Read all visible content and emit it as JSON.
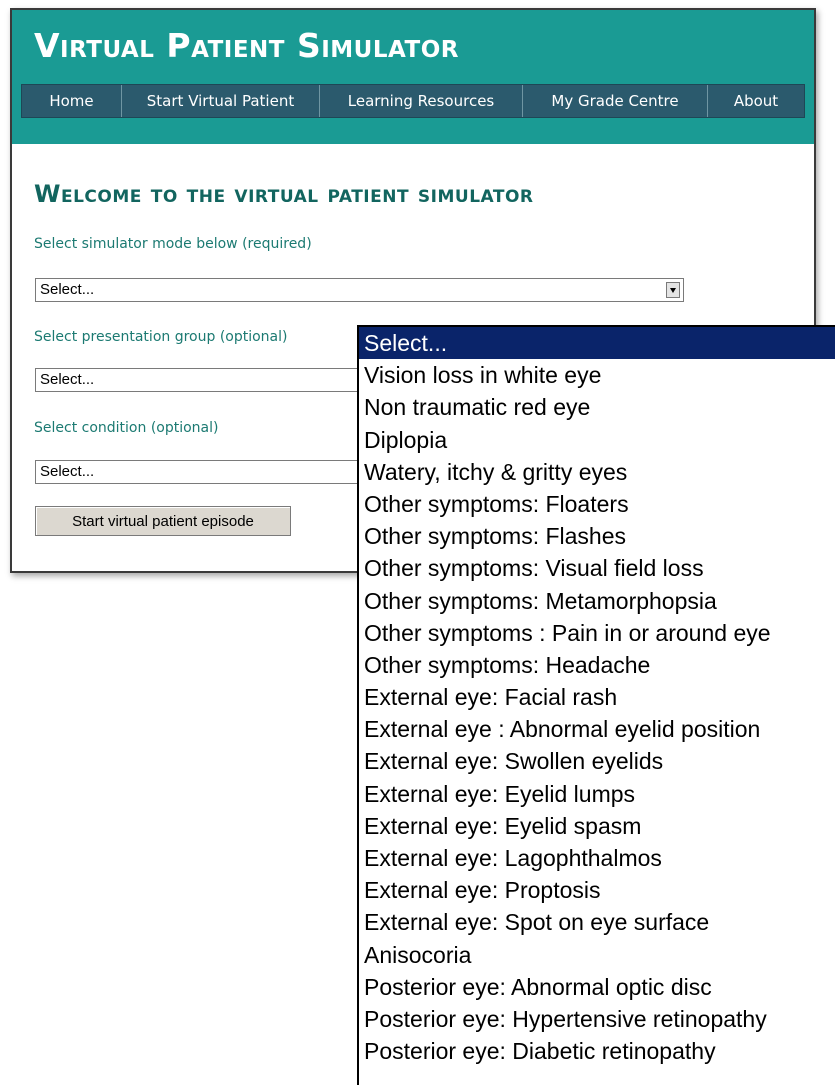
{
  "site": {
    "title": "Virtual Patient Simulator"
  },
  "nav": {
    "items": [
      {
        "label": "Home"
      },
      {
        "label": "Start Virtual Patient"
      },
      {
        "label": "Learning Resources"
      },
      {
        "label": "My Grade Centre"
      },
      {
        "label": "About"
      }
    ]
  },
  "main": {
    "heading": "Welcome to the virtual patient simulator",
    "mode": {
      "label": "Select simulator mode below (required)",
      "value": "Select..."
    },
    "presentation_group": {
      "label": "Select presentation group (optional)",
      "value": "Select..."
    },
    "condition": {
      "label": "Select condition (optional)",
      "value": "Select..."
    },
    "start_button": "Start virtual patient episode"
  },
  "dropdown": {
    "options": [
      "Select...",
      "Vision loss in white eye",
      "Non traumatic red eye",
      "Diplopia",
      "Watery, itchy & gritty eyes",
      "Other symptoms: Floaters",
      "Other symptoms: Flashes",
      "Other symptoms: Visual field loss",
      "Other symptoms: Metamorphopsia",
      "Other symptoms : Pain in or around eye",
      "Other symptoms: Headache",
      "External eye: Facial rash",
      "External eye : Abnormal eyelid position",
      "External eye: Swollen eyelids",
      "External eye: Eyelid lumps",
      "External eye: Eyelid spasm",
      "External eye: Lagophthalmos",
      "External eye: Proptosis",
      "External eye: Spot on eye surface",
      "Anisocoria",
      "Posterior eye: Abnormal optic disc",
      "Posterior eye: Hypertensive retinopathy",
      "Posterior eye: Diabetic retinopathy"
    ],
    "highlighted": "Select..."
  },
  "colors": {
    "header": "#1a9b94",
    "nav": "#2b5a6d",
    "heading": "#12655f",
    "highlight": "#0a246a"
  }
}
